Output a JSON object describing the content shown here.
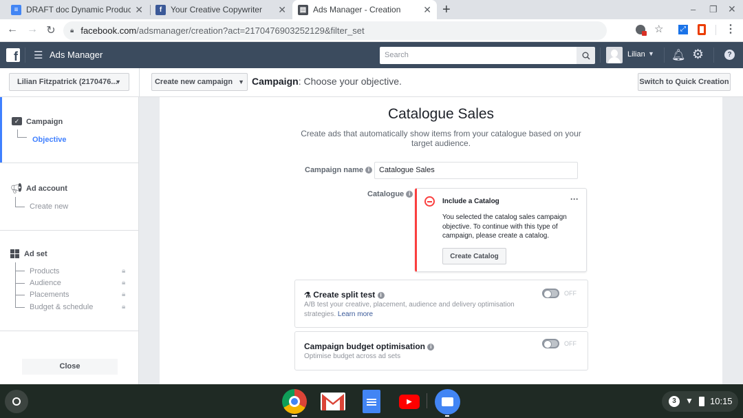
{
  "browser": {
    "tabs": [
      {
        "title": "DRAFT doc Dynamic Product Ad",
        "icon": "google-docs-icon",
        "color": "#4285f4"
      },
      {
        "title": "Your Creative Copywriter",
        "icon": "facebook-icon",
        "color": "#3b5998"
      },
      {
        "title": "Ads Manager - Creation",
        "icon": "ads-manager-icon",
        "color": "#4b4f56",
        "active": true
      }
    ],
    "new_tab": "+",
    "url_host": "facebook.com",
    "url_path": "/adsmanager/creation?act=2170476903252129&filter_set",
    "window_controls": {
      "minimize": "–",
      "restore": "❐",
      "close": "✕"
    }
  },
  "header": {
    "app_name": "Ads Manager",
    "search_placeholder": "Search",
    "user_name": "Lilian"
  },
  "subheader": {
    "account_selector": "Lilian Fitzpatrick (2170476...",
    "create_button": "Create new campaign",
    "heading_bold": "Campaign",
    "heading_rest": ": Choose your objective.",
    "quick_creation_button": "Switch to Quick Creation"
  },
  "sidebar": {
    "campaign": {
      "title": "Campaign",
      "items": [
        "Objective"
      ]
    },
    "ad_account": {
      "title": "Ad account",
      "items": [
        "Create new"
      ]
    },
    "ad_set": {
      "title": "Ad set",
      "items": [
        "Products",
        "Audience",
        "Placements",
        "Budget & schedule"
      ]
    },
    "close_button": "Close"
  },
  "main": {
    "title": "Catalogue Sales",
    "description": "Create ads that automatically show items from your catalogue based on your target audience.",
    "campaign_name_label": "Campaign name",
    "campaign_name_value": "Catalogue Sales",
    "catalogue_label": "Catalogue",
    "alert": {
      "title": "Include a Catalog",
      "body": "You selected the catalog sales campaign objective. To continue with this type of campaign, please create a catalog.",
      "button": "Create Catalog",
      "more": "···"
    },
    "split_test": {
      "title": "Create split test",
      "desc": "A/B test your creative, placement, audience and delivery optimisation strategies.",
      "link": "Learn more",
      "state": "OFF"
    },
    "budget_opt": {
      "title": "Campaign budget optimisation",
      "desc": "Optimise budget across ad sets",
      "state": "OFF"
    }
  },
  "shelf": {
    "notification_count": "3",
    "time": "10:15"
  },
  "colors": {
    "fb_header": "#3b4b5e",
    "accent_blue": "#4080ff",
    "error_red": "#fa3e3e",
    "link": "#385898"
  }
}
